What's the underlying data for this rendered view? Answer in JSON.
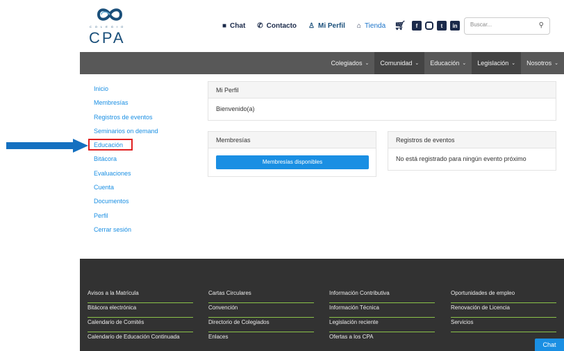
{
  "brand": {
    "logo_text": "CPA",
    "logo_subtext": "COLEGIO"
  },
  "topnav": {
    "chat": "Chat",
    "contacto": "Contacto",
    "mi_perfil": "Mi Perfil",
    "tienda": "Tienda"
  },
  "search": {
    "placeholder": "Buscar..."
  },
  "mainnav": {
    "items": [
      {
        "label": "Colegiados"
      },
      {
        "label": "Comunidad"
      },
      {
        "label": "Educación"
      },
      {
        "label": "Legislación"
      },
      {
        "label": "Nosotros"
      }
    ]
  },
  "sidebar": {
    "items": [
      {
        "label": "Inicio"
      },
      {
        "label": "Membresías"
      },
      {
        "label": "Registros de eventos"
      },
      {
        "label": "Seminarios on demand"
      },
      {
        "label": "Educación"
      },
      {
        "label": "Bitácora"
      },
      {
        "label": "Evaluaciones"
      },
      {
        "label": "Cuenta"
      },
      {
        "label": "Documentos"
      },
      {
        "label": "Perfil"
      },
      {
        "label": "Cerrar sesión"
      }
    ]
  },
  "profile_panel": {
    "title": "Mi Perfil",
    "body": "Bienvenido(a)"
  },
  "memberships_panel": {
    "title": "Membresías",
    "button": "Membresías disponibles"
  },
  "events_panel": {
    "title": "Registros de eventos",
    "body": "No está registrado para ningún evento próximo"
  },
  "footer": {
    "col1": [
      "Avisos a la Matrícula",
      "Bitácora electrónica",
      "Calendario de Comités",
      "Calendario de Educación Continuada"
    ],
    "col2": [
      "Cartas Circulares",
      "Convención",
      "Directorio de Colegiados",
      "Enlaces"
    ],
    "col3": [
      "Información Contributiva",
      "Información Técnica",
      "Legislación reciente",
      "Ofertas a los CPA"
    ],
    "col4": [
      "Oportunidades de empleo",
      "Renovación de Licencia",
      "Servicios"
    ]
  },
  "chat_widget": {
    "label": "Chat"
  },
  "colors": {
    "nav_bg": "#585858",
    "link": "#1a8fe3",
    "primary_button": "#1a8fe3",
    "footer_bg": "#323232",
    "footer_divider": "#8bc34a",
    "annotation_arrow": "#1470c0",
    "annotation_box": "#e02020"
  },
  "icons": [
    "chat-icon",
    "phone-icon",
    "user-icon",
    "shop-icon",
    "cart-icon",
    "facebook-icon",
    "instagram-icon",
    "twitter-icon",
    "linkedin-icon",
    "search-icon",
    "chevron-down-icon"
  ]
}
